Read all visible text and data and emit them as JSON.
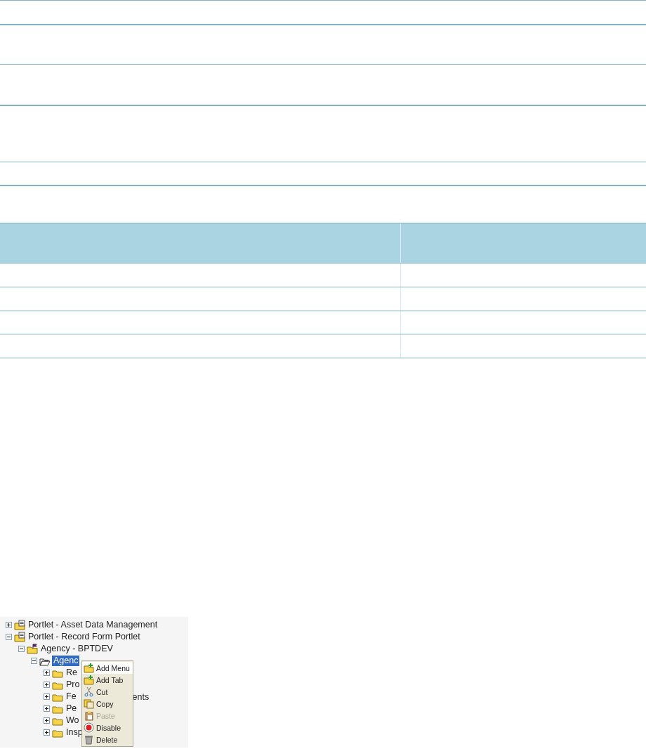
{
  "tree": [
    {
      "label": "Portlet - Asset Data Management",
      "kind": "portlet",
      "expanded": false,
      "selected": false
    },
    {
      "label": "Portlet - Record Form Portlet",
      "kind": "portlet",
      "expanded": true,
      "selected": false,
      "children": [
        {
          "label": "Agency - BPTDEV",
          "kind": "agency",
          "expanded": true,
          "selected": false,
          "children": [
            {
              "label": "Agenc",
              "kind": "folder-open",
              "expanded": true,
              "selected": true,
              "children": [
                {
                  "label": "Re",
                  "kind": "folder",
                  "expanded": false,
                  "selected": false
                },
                {
                  "label": "Pro",
                  "kind": "folder",
                  "expanded": false,
                  "selected": false
                },
                {
                  "label": "Fe",
                  "label_after": "ents",
                  "kind": "folder",
                  "expanded": false,
                  "selected": false
                },
                {
                  "label": "Pe",
                  "kind": "folder",
                  "expanded": false,
                  "selected": false
                },
                {
                  "label": "Wo",
                  "kind": "folder",
                  "expanded": false,
                  "selected": false
                },
                {
                  "label": "Insp",
                  "kind": "folder",
                  "expanded": false,
                  "selected": false
                }
              ]
            }
          ]
        }
      ]
    }
  ],
  "context_menu": [
    {
      "label": "Add Menu",
      "kind": "add-menu",
      "highlighted": true,
      "disabled": false
    },
    {
      "label": "Add Tab",
      "kind": "add-tab",
      "highlighted": false,
      "disabled": false
    },
    {
      "label": "Cut",
      "kind": "cut",
      "highlighted": false,
      "disabled": false
    },
    {
      "label": "Copy",
      "kind": "copy",
      "highlighted": false,
      "disabled": false
    },
    {
      "label": "Paste",
      "kind": "paste",
      "highlighted": false,
      "disabled": true
    },
    {
      "label": "Disable",
      "kind": "disable",
      "highlighted": false,
      "disabled": false
    },
    {
      "label": "Delete",
      "kind": "delete",
      "highlighted": false,
      "disabled": false
    }
  ]
}
